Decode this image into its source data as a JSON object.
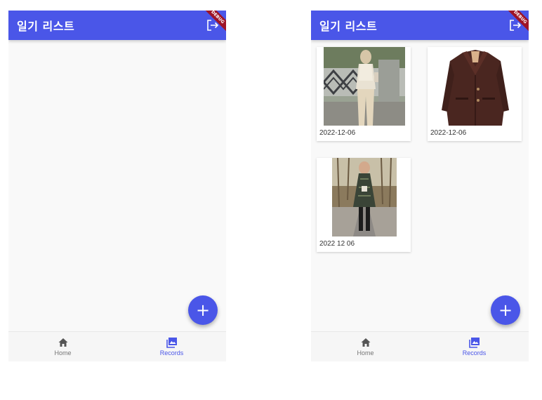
{
  "colors": {
    "primary": "#4a56e8",
    "debug_banner": "#9e1427",
    "background": "#f9f9f9"
  },
  "screens": [
    {
      "appbar": {
        "title": "일기 리스트",
        "logout_icon": "logout-icon",
        "debug_banner": "DEBUG"
      },
      "records": [],
      "fab": {
        "label": "+"
      },
      "bottom_nav": [
        {
          "label": "Home",
          "icon": "home-icon",
          "active": false
        },
        {
          "label": "Records",
          "icon": "photo-library-icon",
          "active": true
        }
      ]
    },
    {
      "appbar": {
        "title": "일기 리스트",
        "logout_icon": "logout-icon",
        "debug_banner": "DEBUG"
      },
      "records": [
        {
          "date": "2022-12-06",
          "image": "woman-knit-vest-photo"
        },
        {
          "date": "2022-12-06",
          "image": "brown-blazer-photo"
        },
        {
          "date": "2022 12 06",
          "image": "woman-plaid-coat-photo"
        }
      ],
      "fab": {
        "label": "+"
      },
      "bottom_nav": [
        {
          "label": "Home",
          "icon": "home-icon",
          "active": false
        },
        {
          "label": "Records",
          "icon": "photo-library-icon",
          "active": true
        }
      ]
    }
  ]
}
